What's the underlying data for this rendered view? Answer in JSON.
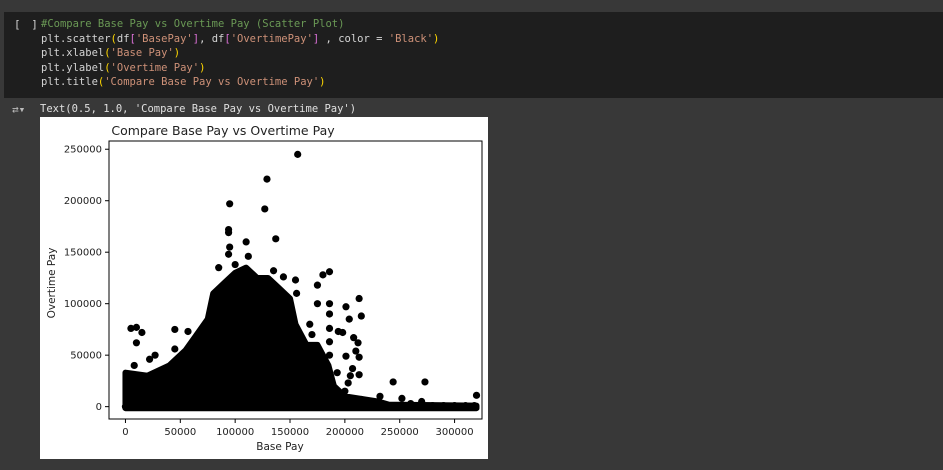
{
  "cell": {
    "run_label": "[ ]",
    "code": {
      "comment": "#Compare Base Pay vs Overtime Pay (Scatter Plot)",
      "line2": {
        "fn": "plt.scatter",
        "a1": "df",
        "s1": "'BasePay'",
        "a2": ", df",
        "s2": "'OvertimePay'",
        "a3": " , color = ",
        "s3": "'Black'"
      },
      "line3": {
        "fn": "plt.xlabel",
        "s": "'Base Pay'"
      },
      "line4": {
        "fn": "plt.ylabel",
        "s": "'Overtime Pay'"
      },
      "line5": {
        "fn": "plt.title",
        "s": "'Compare Base Pay vs Overtime Pay'"
      }
    }
  },
  "output": {
    "text": "Text(0.5, 1.0, 'Compare Base Pay vs Overtime Pay')"
  },
  "chart_data": {
    "type": "scatter",
    "title": "Compare Base Pay vs Overtime Pay",
    "xlabel": "Base Pay",
    "ylabel": "Overtime Pay",
    "xlim": [
      -15000,
      325000
    ],
    "ylim": [
      -12000,
      258000
    ],
    "xticks": [
      "0",
      "50000",
      "100000",
      "150000",
      "200000",
      "250000",
      "300000"
    ],
    "xtick_values": [
      0,
      50000,
      100000,
      150000,
      200000,
      250000,
      300000
    ],
    "yticks": [
      "0",
      "50000",
      "100000",
      "150000",
      "200000",
      "250000"
    ],
    "ytick_values": [
      0,
      50000,
      100000,
      150000,
      200000,
      250000
    ],
    "color": "#000000",
    "dense_region_envelope": [
      [
        0,
        33000
      ],
      [
        20000,
        30000
      ],
      [
        40000,
        40000
      ],
      [
        55000,
        55000
      ],
      [
        65000,
        70000
      ],
      [
        75000,
        85000
      ],
      [
        80000,
        110000
      ],
      [
        90000,
        120000
      ],
      [
        100000,
        130000
      ],
      [
        110000,
        135000
      ],
      [
        120000,
        125000
      ],
      [
        130000,
        125000
      ],
      [
        140000,
        115000
      ],
      [
        150000,
        105000
      ],
      [
        155000,
        80000
      ],
      [
        165000,
        60000
      ],
      [
        175000,
        60000
      ],
      [
        185000,
        40000
      ],
      [
        190000,
        20000
      ],
      [
        200000,
        10000
      ],
      [
        230000,
        5000
      ],
      [
        240000,
        2000
      ],
      [
        320000,
        1000
      ],
      [
        320000,
        -1500
      ],
      [
        0,
        -1500
      ]
    ],
    "points": [
      [
        157000,
        245000
      ],
      [
        129000,
        221000
      ],
      [
        127000,
        192000
      ],
      [
        95000,
        197000
      ],
      [
        94000,
        172000
      ],
      [
        94000,
        169000
      ],
      [
        95000,
        155000
      ],
      [
        110000,
        160000
      ],
      [
        137000,
        163000
      ],
      [
        94000,
        148000
      ],
      [
        112000,
        146000
      ],
      [
        186000,
        131000
      ],
      [
        180000,
        128000
      ],
      [
        175000,
        118000
      ],
      [
        175000,
        100000
      ],
      [
        186000,
        100000
      ],
      [
        186000,
        90000
      ],
      [
        186000,
        76000
      ],
      [
        186000,
        63000
      ],
      [
        186000,
        50000
      ],
      [
        213000,
        105000
      ],
      [
        215000,
        88000
      ],
      [
        201000,
        97000
      ],
      [
        204000,
        85000
      ],
      [
        198000,
        72000
      ],
      [
        194000,
        73000
      ],
      [
        208000,
        67000
      ],
      [
        212000,
        62000
      ],
      [
        210000,
        54000
      ],
      [
        213000,
        48000
      ],
      [
        201000,
        49000
      ],
      [
        213000,
        31000
      ],
      [
        207000,
        37000
      ],
      [
        205000,
        30000
      ],
      [
        203000,
        23000
      ],
      [
        200000,
        15000
      ],
      [
        193000,
        33000
      ],
      [
        168000,
        80000
      ],
      [
        170000,
        70000
      ],
      [
        160000,
        55000
      ],
      [
        5000,
        76000
      ],
      [
        10000,
        77000
      ],
      [
        15000,
        72000
      ],
      [
        10000,
        62000
      ],
      [
        45000,
        75000
      ],
      [
        57000,
        73000
      ],
      [
        22000,
        46000
      ],
      [
        27000,
        50000
      ],
      [
        45000,
        56000
      ],
      [
        244000,
        24000
      ],
      [
        273000,
        24000
      ],
      [
        320000,
        11000
      ],
      [
        252000,
        8000
      ],
      [
        270000,
        5000
      ],
      [
        232000,
        10000
      ],
      [
        215000,
        7000
      ],
      [
        260000,
        3000
      ],
      [
        280000,
        1000
      ],
      [
        290000,
        1000
      ],
      [
        300000,
        1000
      ],
      [
        310000,
        1000
      ],
      [
        318000,
        1000
      ],
      [
        0,
        0
      ],
      [
        1000,
        30000
      ],
      [
        8000,
        40000
      ],
      [
        85000,
        135000
      ],
      [
        100000,
        138000
      ],
      [
        135000,
        132000
      ],
      [
        144000,
        126000
      ],
      [
        155000,
        123000
      ],
      [
        156000,
        110000
      ]
    ]
  }
}
